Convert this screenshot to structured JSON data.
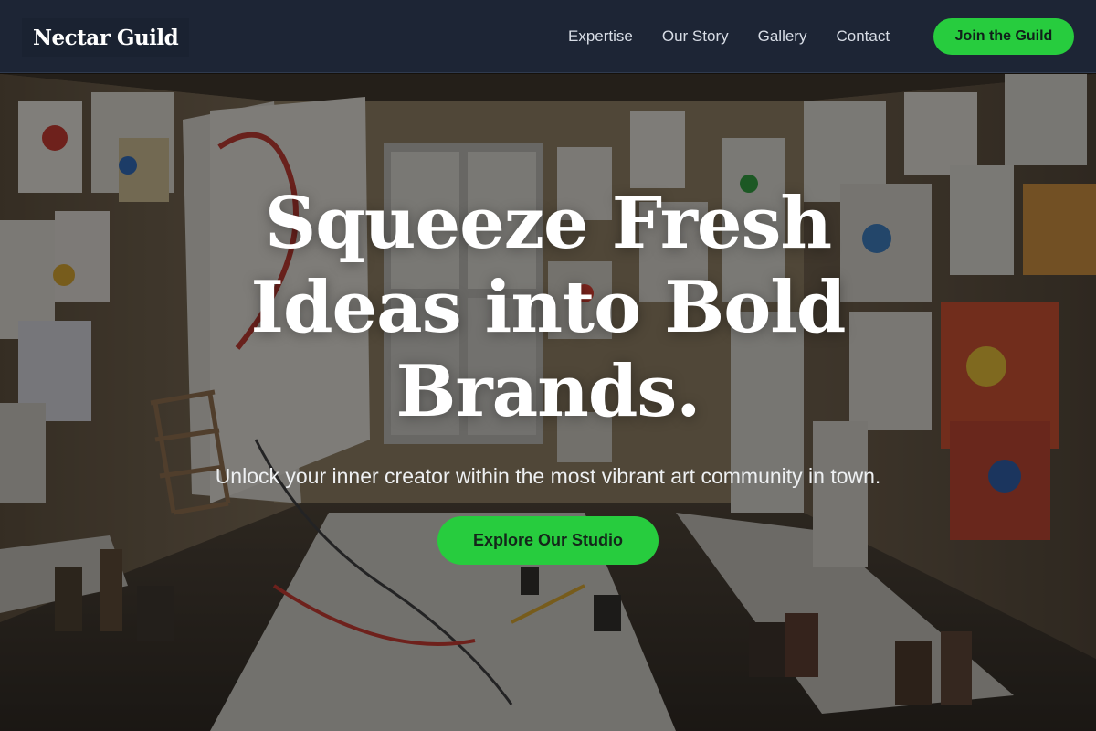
{
  "header": {
    "logo": "Nectar Guild",
    "nav": [
      "Expertise",
      "Our Story",
      "Gallery",
      "Contact"
    ],
    "cta_label": "Join the Guild"
  },
  "hero": {
    "headline_lines": [
      "Squeeze Fresh",
      "Ideas into Bold",
      "Brands."
    ],
    "subtitle": "Unlock your inner creator within the most vibrant art community in town.",
    "cta_label": "Explore Our Studio",
    "background_image": "art-studio-photo"
  },
  "colors": {
    "header_bg": "#1d2535",
    "accent_green": "#27cc3e"
  }
}
